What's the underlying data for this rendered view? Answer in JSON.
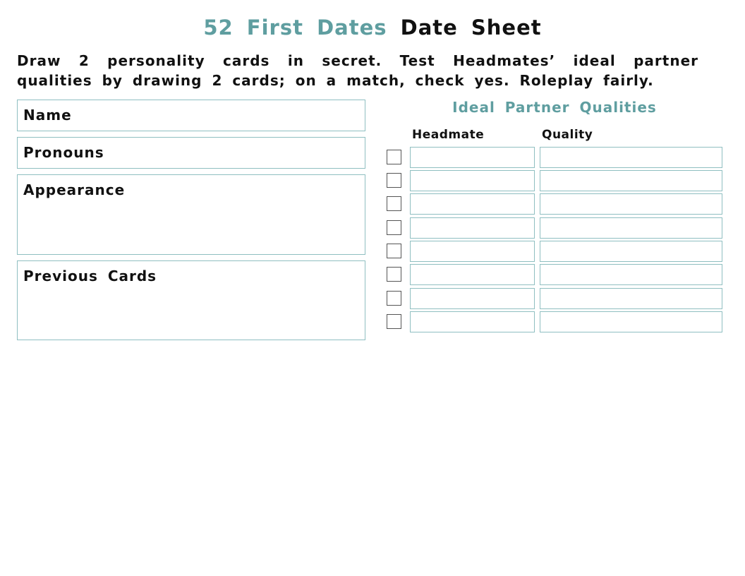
{
  "title": {
    "part1": "52 First Dates",
    "part2": "Date Sheet"
  },
  "instructions": "Draw 2 personality cards in secret. Test Headmates’ ideal partner qualities by drawing 2 cards; on a match, check yes. Roleplay fairly.",
  "fields": [
    {
      "label": "Name",
      "value": ""
    },
    {
      "label": "Pronouns",
      "value": ""
    },
    {
      "label": "Appearance",
      "value": ""
    },
    {
      "label": "Previous Cards",
      "value": ""
    }
  ],
  "qualities": {
    "title": "Ideal Partner Qualities",
    "columns": [
      "Headmate",
      "Quality"
    ],
    "rows": [
      {
        "checked": false,
        "headmate": "",
        "quality": ""
      },
      {
        "checked": false,
        "headmate": "",
        "quality": ""
      },
      {
        "checked": false,
        "headmate": "",
        "quality": ""
      },
      {
        "checked": false,
        "headmate": "",
        "quality": ""
      },
      {
        "checked": false,
        "headmate": "",
        "quality": ""
      },
      {
        "checked": false,
        "headmate": "",
        "quality": ""
      },
      {
        "checked": false,
        "headmate": "",
        "quality": ""
      },
      {
        "checked": false,
        "headmate": "",
        "quality": ""
      }
    ]
  },
  "colors": {
    "accent": "#5f9ea0",
    "border": "#8fbfc1",
    "text": "#111111"
  }
}
